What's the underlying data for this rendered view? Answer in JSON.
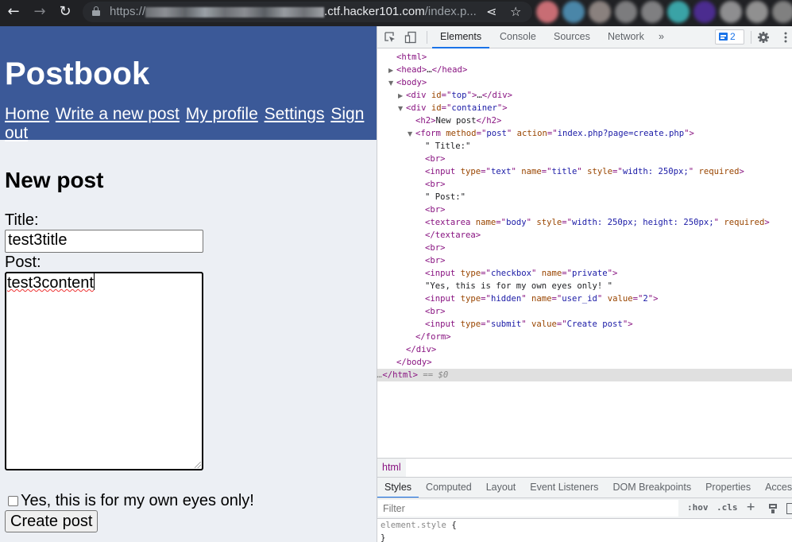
{
  "browser": {
    "url_scheme": "https://",
    "url_host_suffix": ".ctf.hacker101",
    "url_tld": ".com",
    "url_path": "/index.p...",
    "back_icon": "arrow-left-icon",
    "forward_icon": "arrow-right-icon",
    "reload_icon": "reload-icon",
    "share_icon": "share-icon",
    "bookmark_icon": "star-icon",
    "extension_colors": [
      "#c86d74",
      "#4a86a8",
      "#8a817e",
      "#7c7c7e",
      "#7f7f81",
      "#3aa3a6",
      "#4b2c8f",
      "#8e8e90",
      "#909090",
      "#808080"
    ]
  },
  "page": {
    "site_title": "Postbook",
    "nav": [
      {
        "label": "Home"
      },
      {
        "label": "Write a new post"
      },
      {
        "label": "My profile"
      },
      {
        "label": "Settings"
      },
      {
        "label": "Sign out"
      }
    ],
    "heading": "New post",
    "title_label": "Title:",
    "title_value": "test3title",
    "post_label": "Post:",
    "post_value": "test3content",
    "private_label": "Yes, this is for my own eyes only!",
    "private_checked": false,
    "submit_label": "Create post",
    "header_color": "#3b5998",
    "background_color": "#eceff4"
  },
  "devtools": {
    "tabs": [
      {
        "label": "Elements",
        "active": true
      },
      {
        "label": "Console"
      },
      {
        "label": "Sources"
      },
      {
        "label": "Network"
      }
    ],
    "more_tabs": "»",
    "issues_count": "2",
    "dom": [
      {
        "tri": "",
        "parts": [
          [
            "tag",
            "<html>"
          ]
        ]
      },
      {
        "tri": "▶",
        "parts": [
          [
            "tag",
            "<head>"
          ],
          [
            "txt",
            "…"
          ],
          [
            "tag",
            "</head>"
          ]
        ]
      },
      {
        "tri": "▼",
        "parts": [
          [
            "tag",
            "<body>"
          ]
        ]
      },
      {
        "tri": "▶",
        "parts": [
          [
            "tag",
            "<div "
          ],
          [
            "attr",
            "id"
          ],
          [
            "tag",
            "=\""
          ],
          [
            "val",
            "top"
          ],
          [
            "tag",
            "\">"
          ],
          [
            "txt",
            "…"
          ],
          [
            "tag",
            "</div>"
          ]
        ]
      },
      {
        "tri": "▼",
        "parts": [
          [
            "tag",
            "<div "
          ],
          [
            "attr",
            "id"
          ],
          [
            "tag",
            "=\""
          ],
          [
            "val",
            "container"
          ],
          [
            "tag",
            "\">"
          ]
        ]
      },
      {
        "tri": "",
        "parts": [
          [
            "tag",
            "<h2>"
          ],
          [
            "txt",
            "New post"
          ],
          [
            "tag",
            "</h2>"
          ]
        ]
      },
      {
        "tri": "▼",
        "parts": [
          [
            "tag",
            "<form "
          ],
          [
            "attr",
            "method"
          ],
          [
            "tag",
            "=\""
          ],
          [
            "val",
            "post"
          ],
          [
            "tag",
            "\" "
          ],
          [
            "attr",
            "action"
          ],
          [
            "tag",
            "=\""
          ],
          [
            "val",
            "index.php?page=create.php"
          ],
          [
            "tag",
            "\">"
          ]
        ]
      },
      {
        "tri": "",
        "parts": [
          [
            "txt",
            "\" Title:\""
          ]
        ]
      },
      {
        "tri": "",
        "parts": [
          [
            "tag",
            "<br>"
          ]
        ]
      },
      {
        "tri": "",
        "parts": [
          [
            "tag",
            "<input "
          ],
          [
            "attr",
            "type"
          ],
          [
            "tag",
            "=\""
          ],
          [
            "val",
            "text"
          ],
          [
            "tag",
            "\" "
          ],
          [
            "attr",
            "name"
          ],
          [
            "tag",
            "=\""
          ],
          [
            "val",
            "title"
          ],
          [
            "tag",
            "\" "
          ],
          [
            "attr",
            "style"
          ],
          [
            "tag",
            "=\""
          ],
          [
            "val",
            "width: 250px;"
          ],
          [
            "tag",
            "\" "
          ],
          [
            "attr",
            "required"
          ],
          [
            "tag",
            ">"
          ]
        ]
      },
      {
        "tri": "",
        "parts": [
          [
            "tag",
            "<br>"
          ]
        ]
      },
      {
        "tri": "",
        "parts": [
          [
            "txt",
            "\" Post:\""
          ]
        ]
      },
      {
        "tri": "",
        "parts": [
          [
            "tag",
            "<br>"
          ]
        ]
      },
      {
        "tri": "",
        "parts": [
          [
            "tag",
            "<textarea "
          ],
          [
            "attr",
            "name"
          ],
          [
            "tag",
            "=\""
          ],
          [
            "val",
            "body"
          ],
          [
            "tag",
            "\" "
          ],
          [
            "attr",
            "style"
          ],
          [
            "tag",
            "=\""
          ],
          [
            "val",
            "width: 250px; height: 250px;"
          ],
          [
            "tag",
            "\" "
          ],
          [
            "attr",
            "required"
          ],
          [
            "tag",
            ">"
          ]
        ]
      },
      {
        "tri": "",
        "parts": [
          [
            "tag",
            "</textarea>"
          ]
        ]
      },
      {
        "tri": "",
        "parts": [
          [
            "tag",
            "<br>"
          ]
        ]
      },
      {
        "tri": "",
        "parts": [
          [
            "tag",
            "<br>"
          ]
        ]
      },
      {
        "tri": "",
        "parts": [
          [
            "tag",
            "<input "
          ],
          [
            "attr",
            "type"
          ],
          [
            "tag",
            "=\""
          ],
          [
            "val",
            "checkbox"
          ],
          [
            "tag",
            "\" "
          ],
          [
            "attr",
            "name"
          ],
          [
            "tag",
            "=\""
          ],
          [
            "val",
            "private"
          ],
          [
            "tag",
            "\">"
          ]
        ]
      },
      {
        "tri": "",
        "parts": [
          [
            "txt",
            "\"Yes, this is for my own eyes only! \""
          ]
        ]
      },
      {
        "tri": "",
        "parts": [
          [
            "tag",
            "<input "
          ],
          [
            "attr",
            "type"
          ],
          [
            "tag",
            "=\""
          ],
          [
            "val",
            "hidden"
          ],
          [
            "tag",
            "\" "
          ],
          [
            "attr",
            "name"
          ],
          [
            "tag",
            "=\""
          ],
          [
            "val",
            "user_id"
          ],
          [
            "tag",
            "\" "
          ],
          [
            "attr",
            "value"
          ],
          [
            "tag",
            "=\""
          ],
          [
            "val",
            "2"
          ],
          [
            "tag",
            "\">"
          ]
        ]
      },
      {
        "tri": "",
        "parts": [
          [
            "tag",
            "<br>"
          ]
        ]
      },
      {
        "tri": "",
        "parts": [
          [
            "tag",
            "<input "
          ],
          [
            "attr",
            "type"
          ],
          [
            "tag",
            "=\""
          ],
          [
            "val",
            "submit"
          ],
          [
            "tag",
            "\" "
          ],
          [
            "attr",
            "value"
          ],
          [
            "tag",
            "=\""
          ],
          [
            "val",
            "Create post"
          ],
          [
            "tag",
            "\">"
          ]
        ]
      },
      {
        "tri": "",
        "parts": [
          [
            "tag",
            "</form>"
          ]
        ]
      },
      {
        "tri": "",
        "parts": [
          [
            "tag",
            "</div>"
          ]
        ]
      },
      {
        "tri": "",
        "parts": [
          [
            "tag",
            "</body>"
          ]
        ]
      },
      {
        "tri": "",
        "selected": true,
        "parts": [
          [
            "dim",
            "…"
          ],
          [
            "tag",
            "</html>"
          ],
          [
            "dim",
            " == $0"
          ]
        ]
      }
    ],
    "breadcrumb": "html",
    "sub_tabs": [
      {
        "label": "Styles",
        "active": true
      },
      {
        "label": "Computed"
      },
      {
        "label": "Layout"
      },
      {
        "label": "Event Listeners"
      },
      {
        "label": "DOM Breakpoints"
      },
      {
        "label": "Properties"
      },
      {
        "label": "Accessibility"
      }
    ],
    "filter_placeholder": "Filter",
    "hov_label": ":hov",
    "cls_label": ".cls",
    "add_rule_label": "+",
    "styles_rule_selector": "element.style",
    "styles_open_brace": "{",
    "styles_close_brace": "}"
  }
}
